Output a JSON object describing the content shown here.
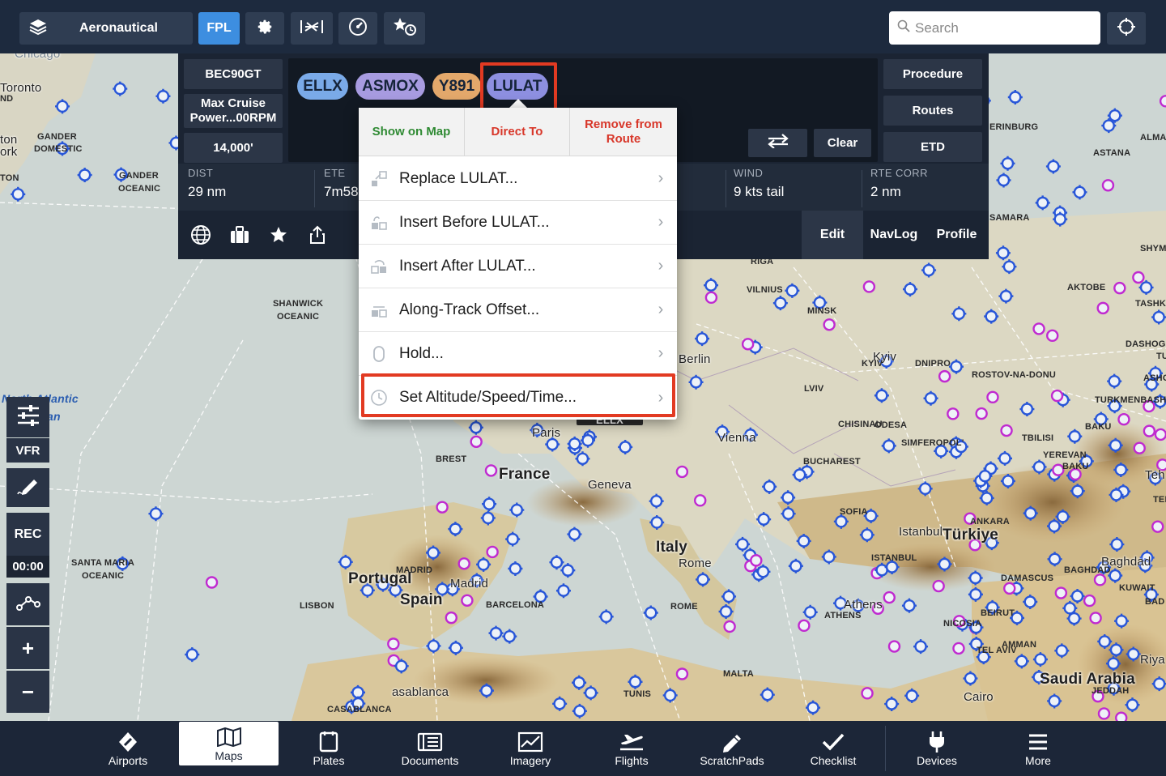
{
  "topbar": {
    "layers_label": "Aeronautical",
    "fpl_label": "FPL",
    "search_placeholder": "Search"
  },
  "fpl": {
    "aircraft": "BEC90GT",
    "performance": "Max Cruise Power...00RPM",
    "altitude": "14,000'",
    "waypoints": [
      {
        "id": "ELLX",
        "color": "#7aaae8"
      },
      {
        "id": "ASMOX",
        "color": "#a79be0"
      },
      {
        "id": "Y891",
        "color": "#e3a86b"
      },
      {
        "id": "LULAT",
        "color": "#8d8fe0"
      }
    ],
    "right_buttons": [
      "Procedure",
      "Routes",
      "ETD"
    ],
    "swap_icon": "swap-arrows-icon",
    "clear_label": "Clear",
    "stats": [
      {
        "key": "DIST",
        "value": "29 nm"
      },
      {
        "key": "ETE",
        "value": "7m58"
      },
      {
        "key": "WIND",
        "value": "9 kts tail"
      },
      {
        "key": "RTE CORR",
        "value": "2 nm"
      }
    ],
    "action_icons": [
      "globe-icon",
      "briefcase-icon",
      "star-icon",
      "share-icon"
    ],
    "tabs": [
      "Edit",
      "NavLog",
      "Profile"
    ]
  },
  "popup": {
    "top_actions": [
      {
        "label": "Show on Map",
        "color": "#2f8a33"
      },
      {
        "label": "Direct To",
        "color": "#d8372a"
      },
      {
        "label": "Remove from Route",
        "color": "#d8372a"
      }
    ],
    "items": [
      "Replace LULAT...",
      "Insert Before LULAT...",
      "Insert After LULAT...",
      "Along-Track Offset...",
      "Hold...",
      "Set Altitude/Speed/Time..."
    ]
  },
  "left_tools": {
    "vfr": "VFR",
    "rec": "REC",
    "rec_time": "00:00",
    "zoom_in": "+",
    "zoom_out": "−"
  },
  "map_labels": {
    "toronto": "Toronto",
    "gander": "GANDER",
    "gander_domestic": "DOMESTIC",
    "gander_oceanic_1": "GANDER",
    "gander_oceanic_2": "OCEANIC",
    "york": "ork",
    "ton": "ton",
    "ton2": "TON",
    "shanwick_1": "SHANWICK",
    "shanwick_2": "OCEANIC",
    "north_atlantic": "North Atlantic",
    "ocean": "an",
    "santa_maria_1": "SANTA MARIA",
    "santa_maria_2": "OCEANIC",
    "brest": "BREST",
    "paris": "Paris",
    "france": "France",
    "geneva": "Geneva",
    "ellx": "ELLX",
    "portugal": "Portugal",
    "spain": "Spain",
    "madrid_up": "MADRID",
    "madrid": "Madrid",
    "lisbon": "LISBON",
    "barcelona": "BARCELONA",
    "casablanca": "CASABLANCA",
    "casablanca_city": "asablanca",
    "italy": "Italy",
    "rome_city": "Rome",
    "rome": "ROME",
    "tunis": "TUNIS",
    "malta": "MALTA",
    "berlin": "Berlin",
    "vienna": "Vienna",
    "riga": "RIGA",
    "vilnius": "VILNIUS",
    "minsk": "MINSK",
    "kyiv_city": "Kyiv",
    "kyiv": "KYIV",
    "dnipro": "DNIPRO",
    "lviv": "LVIV",
    "chisinau": "CHISINAU",
    "odesa": "ODESA",
    "simferopol": "SIMFEROPOL'",
    "bucharest": "BUCHAREST",
    "sofia": "SOFIA",
    "istanbul_city": "Istanbul",
    "istanbul": "ISTANBUL",
    "turkiye": "Türkiye",
    "ankara": "ANKARA",
    "athens_city": "Athens",
    "athens": "ATHENS",
    "nicosia": "NICOSIA",
    "beirut": "BEIRUT",
    "damascus": "DAMASCUS",
    "amman": "AMMAN",
    "tel_aviv": "TEL AVIV",
    "cairo": "Cairo",
    "baghdad_city": "Baghdad",
    "baghdad": "BAGHDAD",
    "kuwait": "KUWAIT",
    "saudi": "Saudi Arabia",
    "jeddah": "JEDDAH",
    "riga_east": "RIGA",
    "rostov": "ROSTOV-NA-DONU",
    "tbilisi": "TBILISI",
    "yerevan": "YEREVAN",
    "baku_up": "BAKU",
    "baku": "BAKU",
    "turkmenbashi": "TURKMENBASH",
    "aktobe": "AKTOBE",
    "samara": "SAMARA",
    "ekaterinburg": "ERINBURG",
    "astana": "ASTANA",
    "alma": "ALMA",
    "tashkent": "TASHK",
    "dashog": "DASHOG",
    "shym": "SHYM",
    "ashg": "ASHG",
    "tehran": "Teh",
    "teh": "TEH",
    "bad": "BAD",
    "riya": "Riya",
    "tu": "TU",
    "chicago": "Chicago",
    "nd": "ND"
  },
  "bottombar": [
    {
      "label": "Airports",
      "icon": "airport-icon"
    },
    {
      "label": "Maps",
      "icon": "map-icon",
      "active": true
    },
    {
      "label": "Plates",
      "icon": "plates-icon"
    },
    {
      "label": "Documents",
      "icon": "documents-icon"
    },
    {
      "label": "Imagery",
      "icon": "imagery-icon"
    },
    {
      "label": "Flights",
      "icon": "flights-icon"
    },
    {
      "label": "ScratchPads",
      "icon": "scratchpad-icon"
    },
    {
      "label": "Checklist",
      "icon": "checklist-icon"
    },
    {
      "label": "Devices",
      "icon": "devices-icon"
    },
    {
      "label": "More",
      "icon": "more-icon"
    }
  ],
  "colors": {
    "accent": "#3d8ee0",
    "highlight": "#e23a22",
    "bar": "#1c2638"
  }
}
